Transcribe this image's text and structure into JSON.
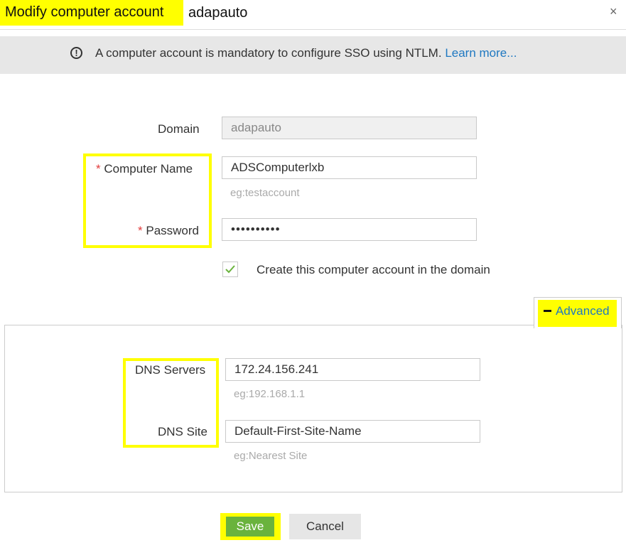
{
  "dialog": {
    "title": "Modify computer account",
    "subtitle": "adapauto",
    "close_glyph": "×"
  },
  "banner": {
    "icon": "exclamation-circle-icon",
    "text": "A computer account is mandatory to configure SSO using NTLM.",
    "link": "Learn more..."
  },
  "form": {
    "domain_label": "Domain",
    "domain_value": "adapauto",
    "required_mark": "*",
    "computer_name_label": "Computer Name",
    "computer_name_value": "ADSComputerlxb",
    "computer_name_hint": "eg:testaccount",
    "password_label": "Password",
    "password_value": "••••••••••",
    "create_checkbox_checked": true,
    "create_checkbox_label": "Create this computer account in the domain"
  },
  "advanced": {
    "toggle_label": "Advanced",
    "dns_servers_label": "DNS Servers",
    "dns_servers_value": "172.24.156.241",
    "dns_servers_hint": "eg:192.168.1.1",
    "dns_site_label": "DNS Site",
    "dns_site_value": "Default-First-Site-Name",
    "dns_site_hint": "eg:Nearest Site"
  },
  "buttons": {
    "save": "Save",
    "cancel": "Cancel"
  },
  "colors": {
    "highlight": "#ffff00",
    "link": "#1f78c1",
    "save": "#6ab33d",
    "required": "#e23c3c"
  }
}
